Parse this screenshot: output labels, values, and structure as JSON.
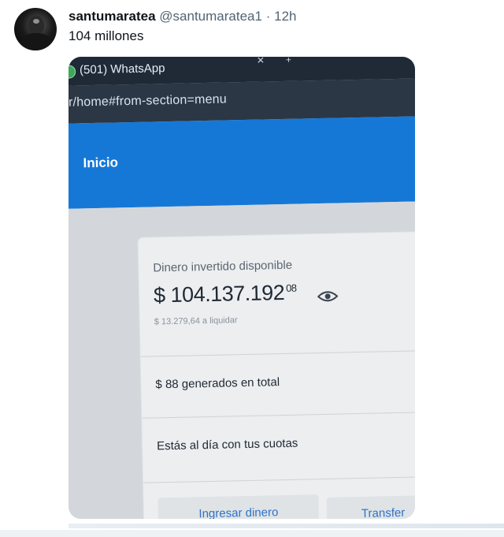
{
  "tweet": {
    "display_name": "santumaratea",
    "handle": "@santumaratea1",
    "separator": "·",
    "time": "12h",
    "text": "104 millones"
  },
  "screenshot": {
    "whatsapp_tab": "(501) WhatsApp",
    "url": "ar/home#from-section=menu",
    "nav_title": "Inicio",
    "balance_label": "Dinero invertido disponible",
    "balance_main": "$ 104.137.192",
    "balance_cents": "08",
    "to_settle": "$ 13.279,64 a liquidar",
    "generated": "$ 88 generados en total",
    "installments_status": "Estás al día con tus cuotas",
    "deposit_button": "Ingresar dinero",
    "transfer_button": "Transfer",
    "colors": {
      "nav_blue": "#1678d6",
      "browser_dark": "#2b3744",
      "button_text": "#2f73c7"
    }
  }
}
